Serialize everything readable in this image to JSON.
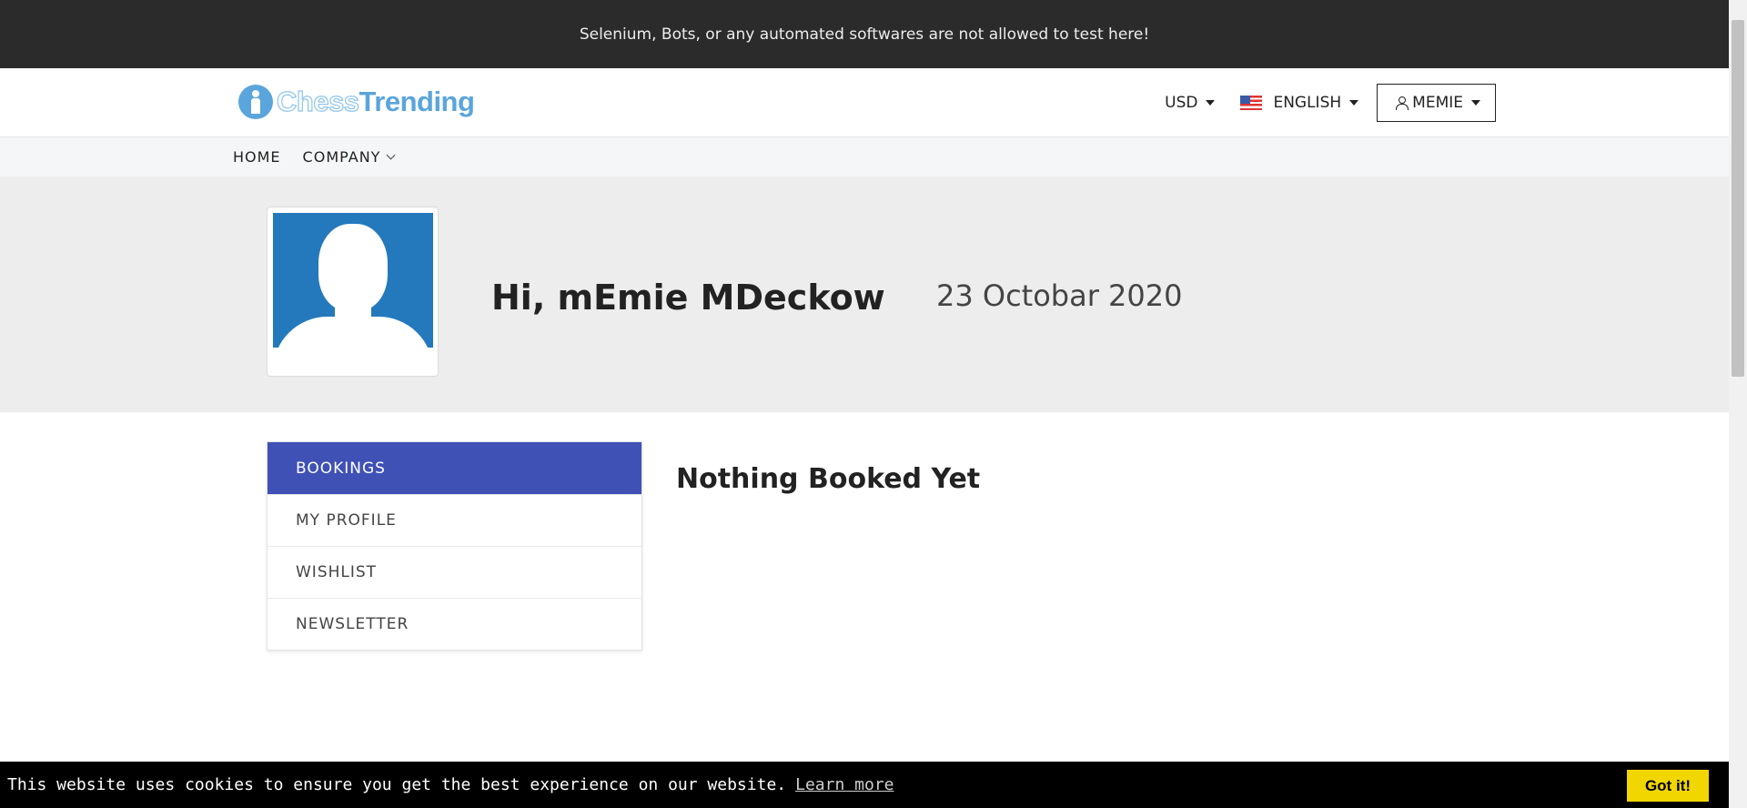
{
  "notice": {
    "text": "Selenium, Bots, or any automated softwares are not allowed to test here!"
  },
  "header": {
    "logo": {
      "part1": "Chess",
      "part2": "Trending"
    },
    "currency": "USD",
    "language": "ENGLISH",
    "user": "MEMIE"
  },
  "nav": {
    "items": [
      "HOME",
      "COMPANY"
    ]
  },
  "profile": {
    "greeting": "Hi, mEmie MDeckow",
    "date": "23 Octobar 2020"
  },
  "sidebar": {
    "items": [
      {
        "label": "BOOKINGS",
        "active": true
      },
      {
        "label": "MY PROFILE"
      },
      {
        "label": "WISHLIST"
      },
      {
        "label": "NEWSLETTER"
      }
    ]
  },
  "main": {
    "empty_title": "Nothing Booked Yet"
  },
  "cookie": {
    "message": "This website uses cookies to ensure you get the best experience on our website.",
    "learn_more": "Learn more",
    "accept": "Got it!"
  },
  "colors": {
    "accent": "#3f51b5",
    "notice_bg": "#2b2b2b",
    "cookie_button": "#f1d600"
  }
}
